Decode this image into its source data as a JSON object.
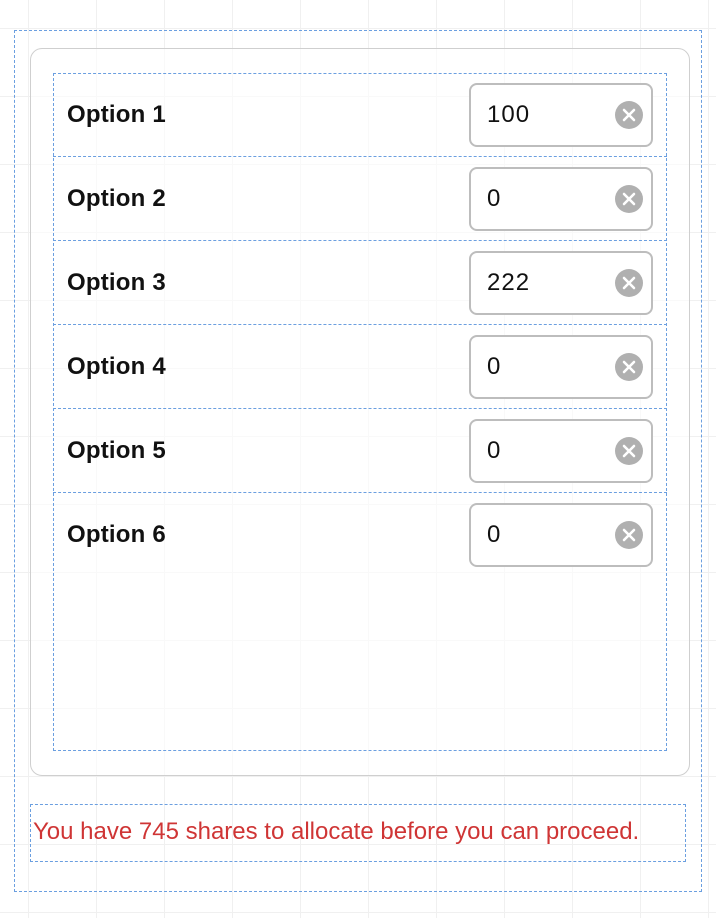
{
  "options": [
    {
      "label": "Option 1",
      "value": "100"
    },
    {
      "label": "Option 2",
      "value": "0"
    },
    {
      "label": "Option 3",
      "value": "222"
    },
    {
      "label": "Option 4",
      "value": "0"
    },
    {
      "label": "Option 5",
      "value": "0"
    },
    {
      "label": "Option 6",
      "value": "0"
    }
  ],
  "status": {
    "message": "You have 745 shares to allocate before you can proceed."
  }
}
